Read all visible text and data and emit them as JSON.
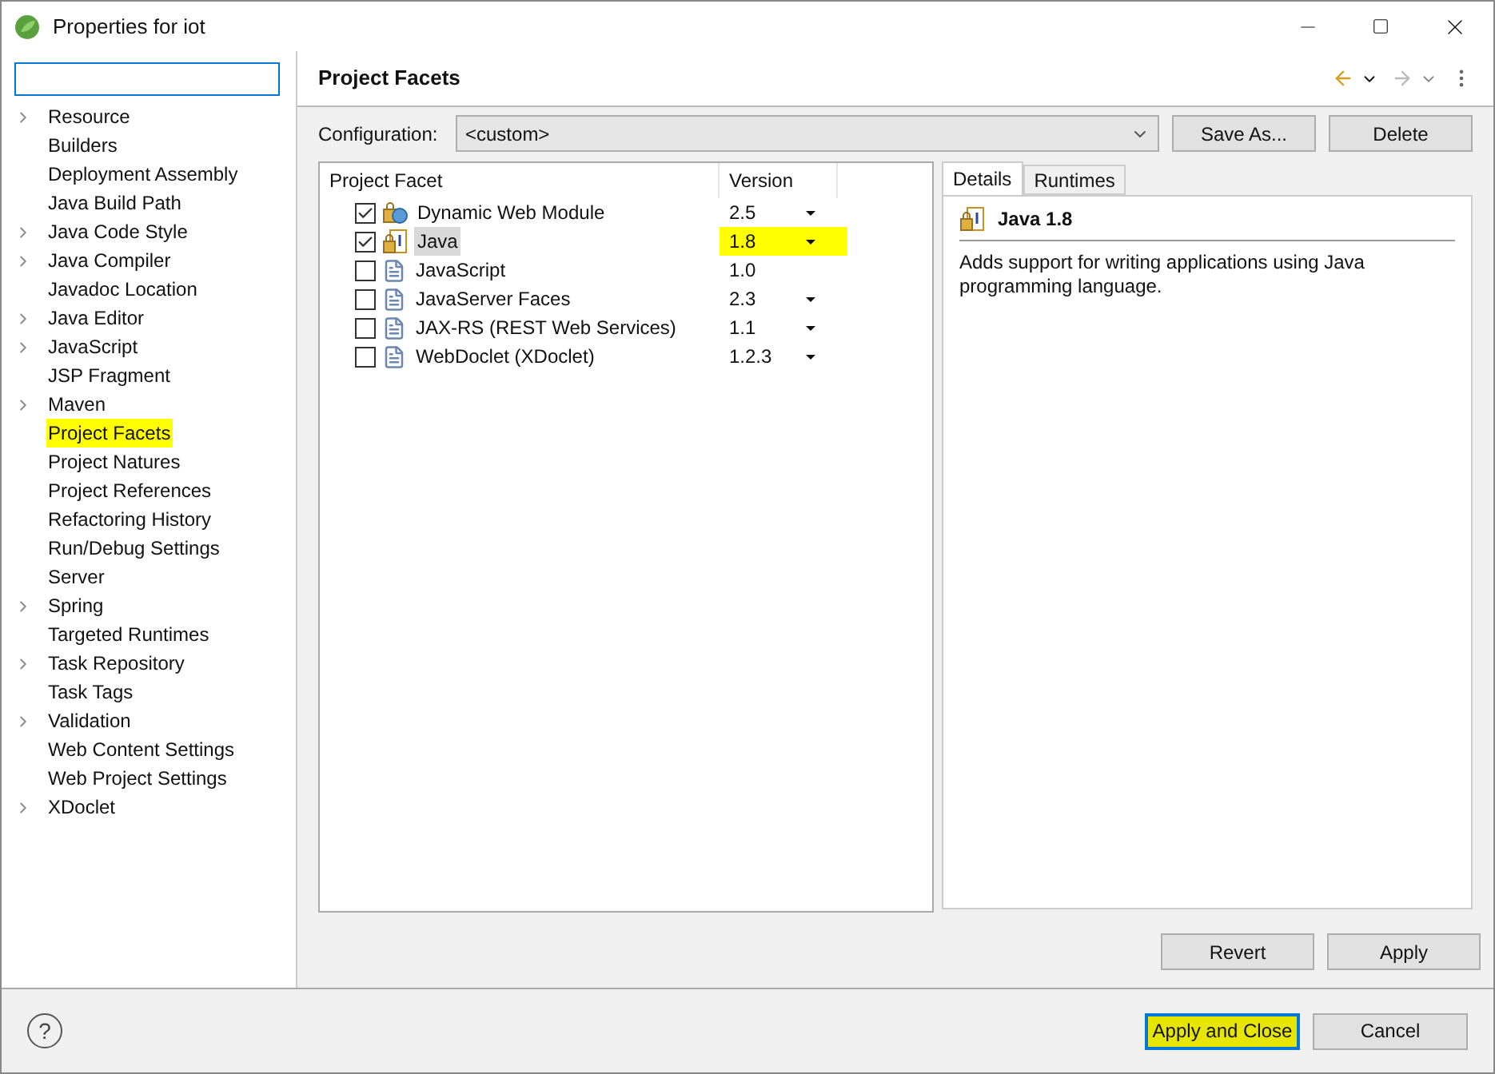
{
  "window": {
    "title": "Properties for iot"
  },
  "sidebar": {
    "items": [
      {
        "label": "Resource",
        "expandable": true,
        "highlighted": false
      },
      {
        "label": "Builders",
        "expandable": false,
        "highlighted": false
      },
      {
        "label": "Deployment Assembly",
        "expandable": false,
        "highlighted": false
      },
      {
        "label": "Java Build Path",
        "expandable": false,
        "highlighted": false
      },
      {
        "label": "Java Code Style",
        "expandable": true,
        "highlighted": false
      },
      {
        "label": "Java Compiler",
        "expandable": true,
        "highlighted": false
      },
      {
        "label": "Javadoc Location",
        "expandable": false,
        "highlighted": false
      },
      {
        "label": "Java Editor",
        "expandable": true,
        "highlighted": false
      },
      {
        "label": "JavaScript",
        "expandable": true,
        "highlighted": false
      },
      {
        "label": "JSP Fragment",
        "expandable": false,
        "highlighted": false
      },
      {
        "label": "Maven",
        "expandable": true,
        "highlighted": false
      },
      {
        "label": "Project Facets",
        "expandable": false,
        "highlighted": true
      },
      {
        "label": "Project Natures",
        "expandable": false,
        "highlighted": false
      },
      {
        "label": "Project References",
        "expandable": false,
        "highlighted": false
      },
      {
        "label": "Refactoring History",
        "expandable": false,
        "highlighted": false
      },
      {
        "label": "Run/Debug Settings",
        "expandable": false,
        "highlighted": false
      },
      {
        "label": "Server",
        "expandable": false,
        "highlighted": false
      },
      {
        "label": "Spring",
        "expandable": true,
        "highlighted": false
      },
      {
        "label": "Targeted Runtimes",
        "expandable": false,
        "highlighted": false
      },
      {
        "label": "Task Repository",
        "expandable": true,
        "highlighted": false
      },
      {
        "label": "Task Tags",
        "expandable": false,
        "highlighted": false
      },
      {
        "label": "Validation",
        "expandable": true,
        "highlighted": false
      },
      {
        "label": "Web Content Settings",
        "expandable": false,
        "highlighted": false
      },
      {
        "label": "Web Project Settings",
        "expandable": false,
        "highlighted": false
      },
      {
        "label": "XDoclet",
        "expandable": true,
        "highlighted": false
      }
    ]
  },
  "page": {
    "title": "Project Facets",
    "configuration": {
      "label": "Configuration:",
      "value": "<custom>"
    },
    "config_buttons": [
      "Save As...",
      "Delete"
    ],
    "facets_table": {
      "columns": [
        "Project Facet",
        "Version"
      ],
      "rows": [
        {
          "kind": "module",
          "name": "Dynamic Web Module",
          "version": "2.5",
          "dropdown": true,
          "checked": true,
          "selected": false,
          "highlighted": false
        },
        {
          "kind": "java",
          "name": "Java",
          "version": "1.8",
          "dropdown": true,
          "checked": true,
          "selected": true,
          "highlighted": true
        },
        {
          "kind": "doc",
          "name": "JavaScript",
          "version": "1.0",
          "dropdown": false,
          "checked": false,
          "selected": false,
          "highlighted": false
        },
        {
          "kind": "doc",
          "name": "JavaServer Faces",
          "version": "2.3",
          "dropdown": true,
          "checked": false,
          "selected": false,
          "highlighted": false
        },
        {
          "kind": "doc",
          "name": "JAX-RS (REST Web Services)",
          "version": "1.1",
          "dropdown": true,
          "checked": false,
          "selected": false,
          "highlighted": false
        },
        {
          "kind": "doc",
          "name": "WebDoclet (XDoclet)",
          "version": "1.2.3",
          "dropdown": true,
          "checked": false,
          "selected": false,
          "highlighted": false
        }
      ]
    },
    "details": {
      "tabs": [
        {
          "label": "Details",
          "selected": true
        },
        {
          "label": "Runtimes",
          "selected": false
        }
      ],
      "heading": "Java 1.8",
      "description": "Adds support for writing applications using Java programming language."
    },
    "page_buttons": [
      {
        "label": "Revert"
      },
      {
        "label": "Apply"
      }
    ]
  },
  "help": {
    "symbol": "?"
  },
  "footer_buttons": [
    {
      "label": "Apply and Close",
      "default": true,
      "highlighted": true
    },
    {
      "label": "Cancel",
      "default": false,
      "highlighted": false
    }
  ]
}
